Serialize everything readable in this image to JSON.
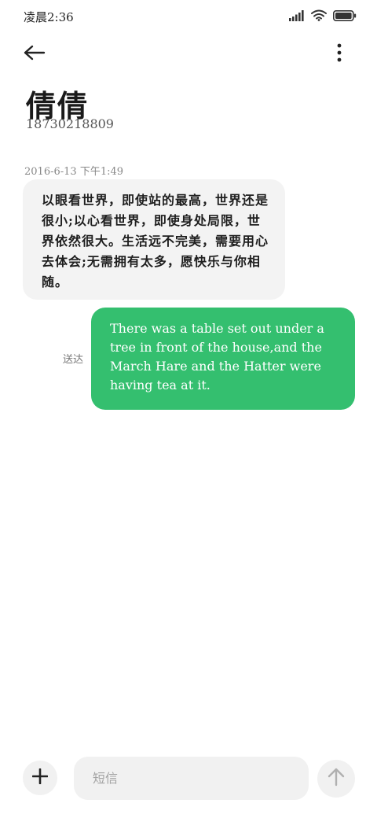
{
  "status_bar": {
    "time": "凌晨2:36",
    "icons": [
      "signal-icon",
      "wifi-icon",
      "battery-icon"
    ]
  },
  "header": {
    "back_icon": "back-arrow-icon",
    "more_icon": "more-vertical-icon",
    "contact_name": "倩倩",
    "contact_number": "18730218809"
  },
  "conversation": {
    "timestamp": "2016-6-13 下午1:49",
    "incoming_message": "以眼看世界，即使站的最高，世界还是很小;以心看世界，即使身处局限，世界依然很大。生活远不完美，需要用心去体会;无需拥有太多，愿快乐与你相随。",
    "outgoing_message": "There was a table set out under a tree in front of the house,and the March Hare and the Hatter were having tea at it.",
    "outgoing_status": "送达"
  },
  "composer": {
    "add_icon": "plus-icon",
    "placeholder": "短信",
    "value": "",
    "send_icon": "send-arrow-up-icon"
  },
  "colors": {
    "outgoing_bubble": "#34bf6f",
    "incoming_bubble": "#f3f3f3",
    "composer_bg": "#f1f1f1"
  }
}
